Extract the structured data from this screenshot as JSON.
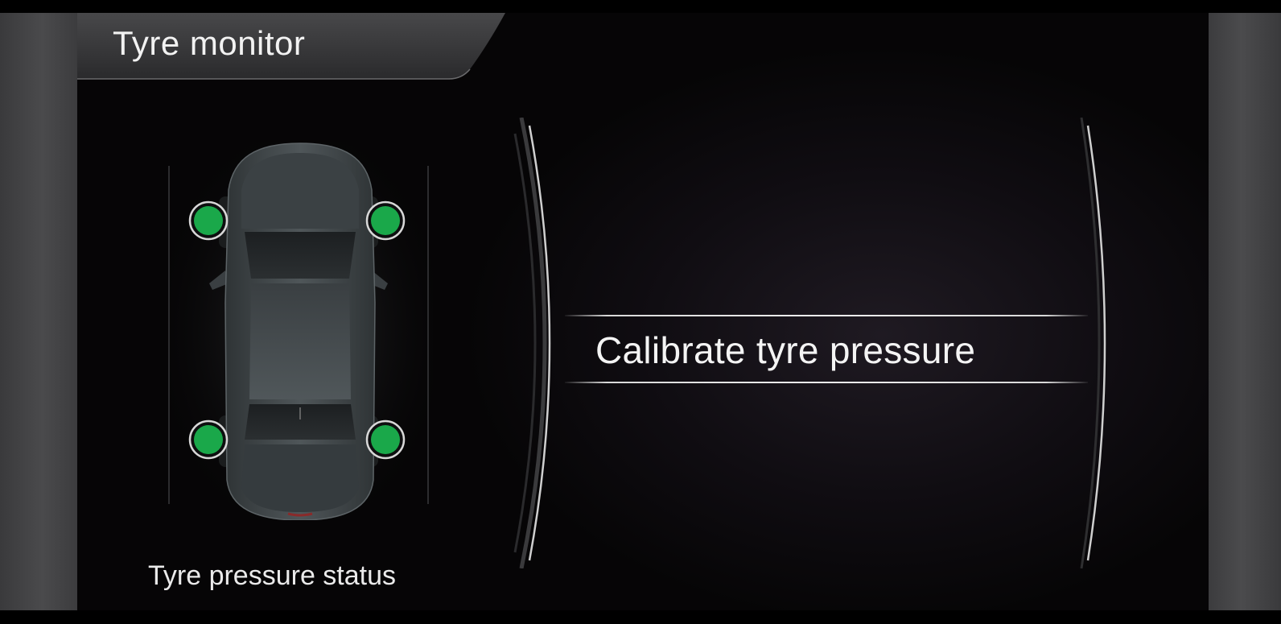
{
  "header": {
    "title": "Tyre monitor"
  },
  "car_status": {
    "label": "Tyre pressure status",
    "tyres": [
      {
        "position": "front-left",
        "status_color": "#1aa84a"
      },
      {
        "position": "front-right",
        "status_color": "#1aa84a"
      },
      {
        "position": "rear-left",
        "status_color": "#1aa84a"
      },
      {
        "position": "rear-right",
        "status_color": "#1aa84a"
      }
    ]
  },
  "menu": {
    "items": [
      {
        "label": "Calibrate tyre pressure",
        "selected": true
      }
    ]
  },
  "colors": {
    "ok": "#1aa84a",
    "text": "#f2f2f2",
    "background": "#0b090c"
  }
}
